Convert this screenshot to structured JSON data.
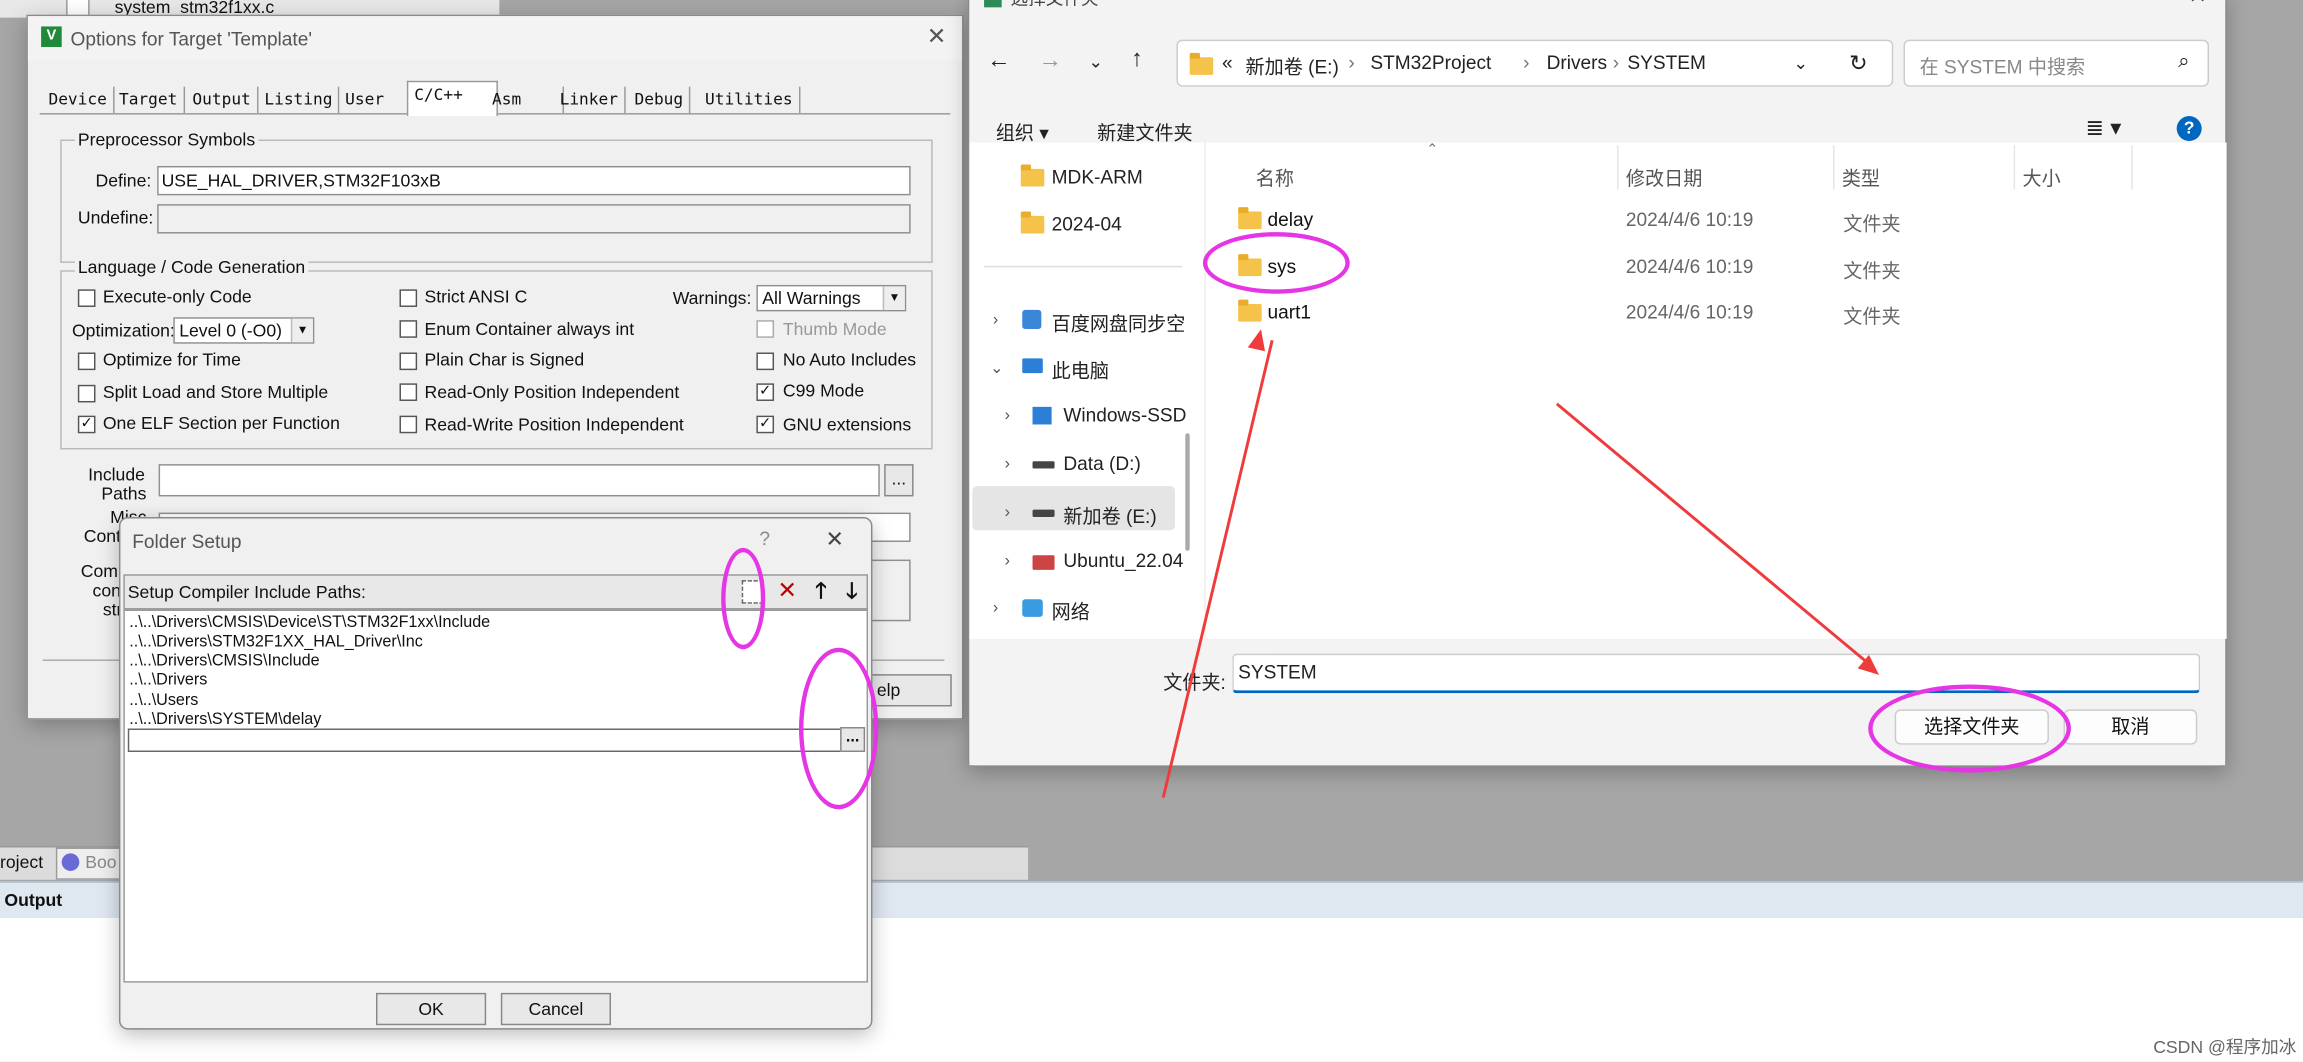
{
  "editor": {
    "file_tab": "system_stm32f1xx.c",
    "project_tab": "roject",
    "books_tab": "Boo",
    "output_label": "Output"
  },
  "options_dialog": {
    "title": "Options for Target 'Template'",
    "tabs": [
      "Device",
      "Target",
      "Output",
      "Listing",
      "User",
      "C/C++",
      "Asm",
      "Linker",
      "Debug",
      "Utilities"
    ],
    "active_tab": "C/C++",
    "preprocessor": {
      "group_label": "Preprocessor Symbols",
      "define_label": "Define:",
      "define_value": "USE_HAL_DRIVER,STM32F103xB",
      "undefine_label": "Undefine:",
      "undefine_value": ""
    },
    "codegen": {
      "group_label": "Language / Code Generation",
      "execute_only": {
        "label": "Execute-only Code",
        "checked": false
      },
      "optimization_label": "Optimization:",
      "optimization_value": "Level 0 (-O0)",
      "optimize_time": {
        "label": "Optimize for Time",
        "checked": false
      },
      "split_load": {
        "label": "Split Load and Store Multiple",
        "checked": false
      },
      "one_elf": {
        "label": "One ELF Section per Function",
        "checked": true
      },
      "strict_ansi": {
        "label": "Strict ANSI C",
        "checked": false
      },
      "enum_container": {
        "label": "Enum Container always int",
        "checked": false
      },
      "plain_char": {
        "label": "Plain Char is Signed",
        "checked": false
      },
      "ro_pos": {
        "label": "Read-Only Position Independent",
        "checked": false
      },
      "rw_pos": {
        "label": "Read-Write Position Independent",
        "checked": false
      },
      "warnings_label": "Warnings:",
      "warnings_value": "All Warnings",
      "thumb_mode": {
        "label": "Thumb Mode",
        "checked": false
      },
      "no_auto": {
        "label": "No Auto Includes",
        "checked": false
      },
      "c99": {
        "label": "C99 Mode",
        "checked": true
      },
      "gnu_ext": {
        "label": "GNU extensions",
        "checked": true
      }
    },
    "include_label1": "Include",
    "include_label2": "Paths",
    "misc_label1": "Misc",
    "misc_label2": "Contr",
    "comp_label1": "Comp",
    "comp_label2": "con",
    "comp_label3": "str",
    "help_partial": "elp"
  },
  "folder_setup": {
    "title": "Folder Setup",
    "help_glyph": "?",
    "close_glyph": "✕",
    "header": "Setup Compiler Include Paths:",
    "paths": [
      "..\\..\\Drivers\\CMSIS\\Device\\ST\\STM32F1xx\\Include",
      "..\\..\\Drivers\\STM32F1XX_HAL_Driver\\Inc",
      "..\\..\\Drivers\\CMSIS\\Include",
      "..\\..\\Drivers",
      "..\\..\\Users",
      "..\\..\\Drivers\\SYSTEM\\delay"
    ],
    "browse_label": "...",
    "ok_label": "OK",
    "cancel_label": "Cancel"
  },
  "file_dialog": {
    "title": "选择文件夹",
    "breadcrumb": [
      "新加卷 (E:)",
      "STM32Project",
      "Drivers",
      "SYSTEM"
    ],
    "breadcrumb_prefix": "«",
    "search_placeholder": "在 SYSTEM 中搜索",
    "organize_label": "组织 ▾",
    "new_folder_label": "新建文件夹",
    "columns": {
      "name": "名称",
      "date": "修改日期",
      "type": "类型",
      "size": "大小"
    },
    "files": [
      {
        "name": "delay",
        "date": "2024/4/6 10:19",
        "type": "文件夹"
      },
      {
        "name": "sys",
        "date": "2024/4/6 10:19",
        "type": "文件夹"
      },
      {
        "name": "uart1",
        "date": "2024/4/6 10:19",
        "type": "文件夹"
      }
    ],
    "nav": {
      "mdk": "MDK-ARM",
      "d202404": "2024-04",
      "baidu": "百度网盘同步空",
      "pc": "此电脑",
      "windows": "Windows-SSD",
      "data": "Data (D:)",
      "e": "新加卷 (E:)",
      "ubuntu": "Ubuntu_22.04",
      "network": "网络"
    },
    "folder_label": "文件夹:",
    "folder_value": "SYSTEM",
    "select_label": "选择文件夹",
    "cancel_label": "取消"
  },
  "watermark": "CSDN @程序加冰",
  "colors": {
    "annotation_circle": "#e535e5",
    "annotation_arrow": "#ef3b3b",
    "accent": "#0067c0"
  }
}
